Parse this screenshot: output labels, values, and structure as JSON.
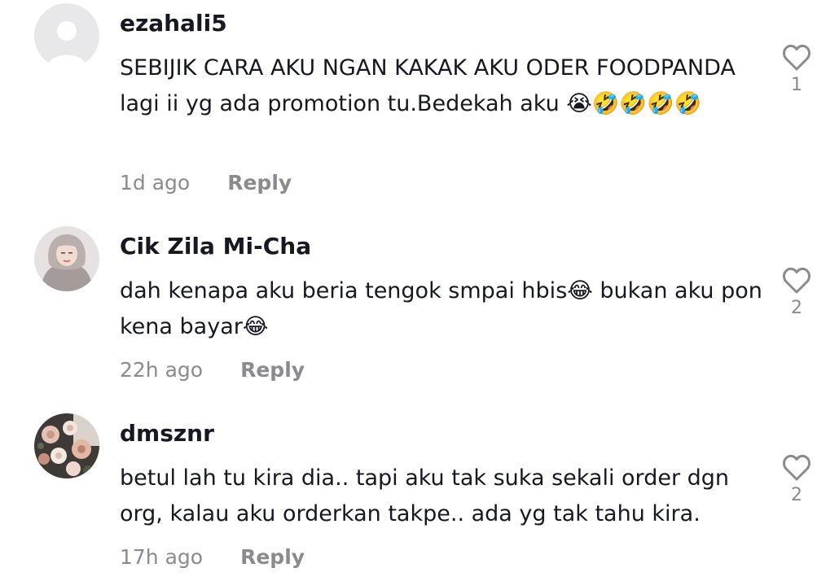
{
  "comments": [
    {
      "username": "ezahali5",
      "text": "SEBIJIK CARA AKU NGAN KAKAK AKU ODER FOODPANDA lagi ii yg ada promotion tu.Bedekah aku 😭🤣🤣🤣🤣",
      "time": "1d ago",
      "reply": "Reply",
      "likes": "1",
      "avatar": "default-avatar"
    },
    {
      "username": "Cik Zila Mi-Cha",
      "text": "dah kenapa aku beria tengok smpai hbis😂 bukan aku pon kena bayar😂",
      "time": "22h ago",
      "reply": "Reply",
      "likes": "2",
      "avatar": "hijab-portrait-avatar"
    },
    {
      "username": "dmsznr",
      "text": "betul lah tu kira dia.. tapi aku tak suka sekali order dgn org, kalau aku orderkan takpe.. ada yg tak tahu kira.",
      "time": "17h ago",
      "reply": "Reply",
      "likes": "2",
      "avatar": "flower-bouquet-avatar"
    }
  ],
  "colors": {
    "text": "#161823",
    "muted": "#8a8b91",
    "background": "#ffffff"
  }
}
